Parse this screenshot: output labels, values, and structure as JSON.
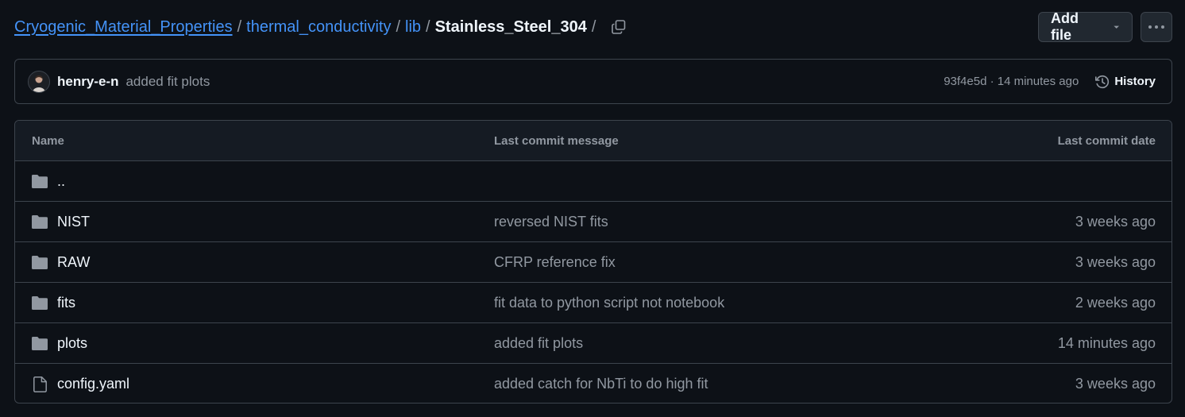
{
  "breadcrumb": {
    "repo": "Cryogenic_Material_Properties",
    "path": [
      "thermal_conductivity",
      "lib"
    ],
    "current": "Stainless_Steel_304",
    "separator": "/"
  },
  "actions": {
    "add_file_label": "Add file"
  },
  "commit": {
    "author": "henry-e-n",
    "message": "added fit plots",
    "meta": "93f4e5d · 14 minutes ago",
    "history_label": "History"
  },
  "table": {
    "headers": {
      "name": "Name",
      "message": "Last commit message",
      "date": "Last commit date"
    },
    "rows": [
      {
        "name": "..",
        "type": "folder",
        "message": "",
        "date": ""
      },
      {
        "name": "NIST",
        "type": "folder",
        "message": "reversed NIST fits",
        "date": "3 weeks ago"
      },
      {
        "name": "RAW",
        "type": "folder",
        "message": "CFRP reference fix",
        "date": "3 weeks ago"
      },
      {
        "name": "fits",
        "type": "folder",
        "message": "fit data to python script not notebook",
        "date": "2 weeks ago"
      },
      {
        "name": "plots",
        "type": "folder",
        "message": "added fit plots",
        "date": "14 minutes ago"
      },
      {
        "name": "config.yaml",
        "type": "file",
        "message": "added catch for NbTi to do high fit",
        "date": "3 weeks ago"
      }
    ]
  },
  "colors": {
    "background": "#0d1117",
    "link": "#4493f8",
    "border": "#3d444d",
    "muted": "#9198a1",
    "text": "#f0f6fc"
  }
}
